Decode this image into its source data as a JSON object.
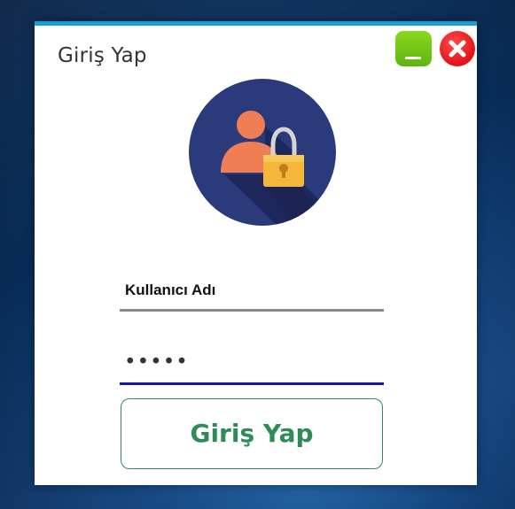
{
  "window": {
    "title": "Giriş Yap",
    "accent_color": "#17a0d4"
  },
  "title_buttons": {
    "minimize_icon": "minimize-icon",
    "close_icon": "close-icon",
    "minimize_color": "#6cc417",
    "close_color": "#e31b1b"
  },
  "avatar": {
    "icon": "user-lock-icon",
    "background_color": "#2b3a7a"
  },
  "form": {
    "username_value": "Kullanıcı Adı",
    "password_value": "•••••",
    "login_label": "Giriş Yap",
    "login_color": "#2e8b57"
  }
}
